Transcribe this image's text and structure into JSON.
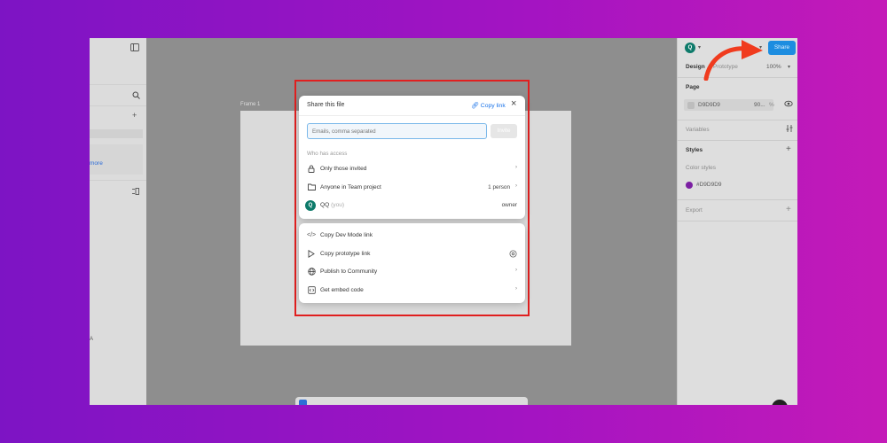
{
  "left_panel": {
    "more_link": "more",
    "lower_label": "A"
  },
  "canvas": {
    "frame_label": "Frame 1"
  },
  "right_panel": {
    "avatar_letter": "Q",
    "share_label": "Share",
    "tabs": {
      "design": "Design",
      "prototype": "Prototype"
    },
    "zoom": "100%",
    "page": {
      "title": "Page",
      "color_hex": "D9D9D9",
      "opacity": "90...",
      "opacity_unit": "%"
    },
    "variables": "Variables",
    "styles": "Styles",
    "color_styles_label": "Color styles",
    "color_style_name": "#D9D9D9",
    "export": "Export",
    "colors": {
      "style_swatch": "#7b1fa2",
      "page_swatch": "#bdbdbd",
      "share_bg": "#1d8de0"
    }
  },
  "dialog": {
    "title": "Share this file",
    "copy_link": "Copy link",
    "email_placeholder": "Emails, comma separated",
    "invite_label": "Invite",
    "who_has_access": "Who has access",
    "rows": [
      {
        "icon": "lock-icon",
        "label": "Only those invited",
        "right": ""
      },
      {
        "icon": "folder-icon",
        "label": "Anyone in Team project",
        "right": "1 person"
      }
    ],
    "owner": {
      "initial": "Q",
      "name": "QQ",
      "you": "(you)",
      "role": "owner"
    }
  },
  "actions": {
    "items": [
      {
        "icon": "code-icon",
        "label": "Copy Dev Mode link"
      },
      {
        "icon": "play-icon",
        "label": "Copy prototype link"
      },
      {
        "icon": "globe-icon",
        "label": "Publish to Community"
      },
      {
        "icon": "embed-icon",
        "label": "Get embed code"
      }
    ]
  }
}
